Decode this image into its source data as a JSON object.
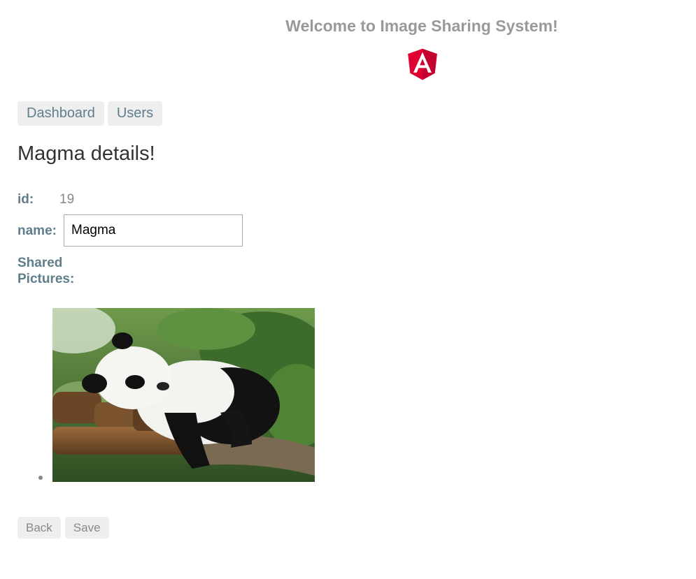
{
  "app": {
    "title": "Welcome to Image Sharing System!",
    "logo_icon": "angular-logo-icon"
  },
  "nav": {
    "dashboard_label": "Dashboard",
    "users_label": "Users"
  },
  "detail": {
    "heading": "Magma details!",
    "id_label": "id:",
    "id_value": "19",
    "name_label": "name:",
    "name_value": "Magma",
    "shared_label": "Shared Pictures:"
  },
  "pictures": [
    {
      "subject": "sleeping panda on wooden logs"
    }
  ],
  "actions": {
    "back_label": "Back",
    "save_label": "Save"
  },
  "colors": {
    "accent": "#607d8b",
    "brand": "#dd0031",
    "button_bg": "#eeeeee"
  }
}
